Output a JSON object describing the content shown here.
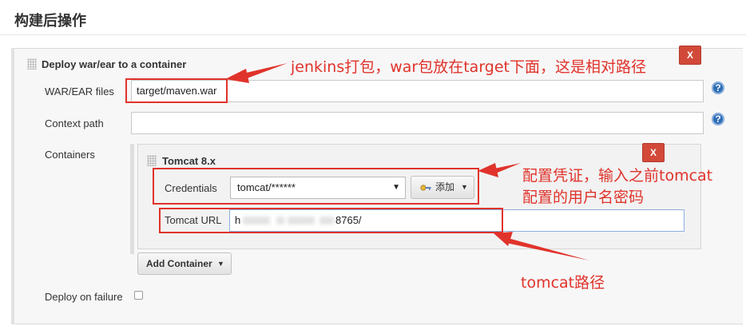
{
  "section": {
    "title": "构建后操作"
  },
  "step": {
    "title": "Deploy war/ear to a container",
    "delete_label": "X",
    "war_label": "WAR/EAR files",
    "war_value": "target/maven.war",
    "context_label": "Context path",
    "context_value": "",
    "containers_label": "Containers",
    "help_glyph": "?"
  },
  "container": {
    "title": "Tomcat 8.x",
    "delete_label": "X",
    "credentials_label": "Credentials",
    "credentials_value": "tomcat/******",
    "add_label": "添加",
    "url_label": "Tomcat URL",
    "url_prefix": "h",
    "url_suffix": "8765/"
  },
  "add_container_label": "Add Container",
  "deploy_on_failure_label": "Deploy on failure",
  "deploy_on_failure_checked": false,
  "annotations": {
    "war": "jenkins打包，war包放在target下面，这是相对路径",
    "cred_line1": "配置凭证，输入之前tomcat",
    "cred_line2": "配置的用户名密码",
    "url": "tomcat路径"
  },
  "colors": {
    "annotation": "#e0332b",
    "delete": "#d24939",
    "help": "#2f6db5"
  },
  "icons": {
    "help": "help-icon",
    "key": "key-icon",
    "drag": "drag-handle-icon",
    "caret": "caret-down-icon"
  }
}
